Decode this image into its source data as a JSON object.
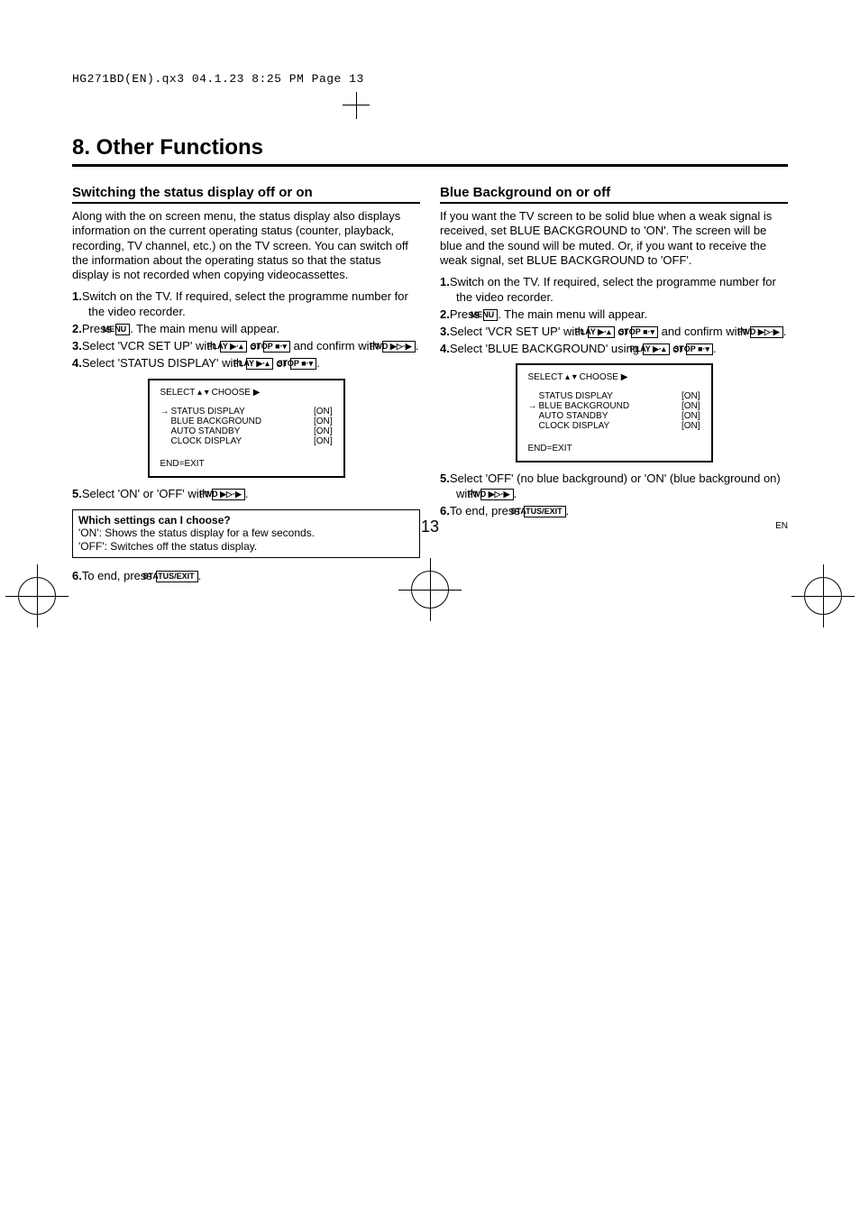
{
  "print_header": "HG271BD(EN).qx3  04.1.23  8:25 PM  Page 13",
  "chapter": "8. Other Functions",
  "left": {
    "title": "Switching the status display off or on",
    "intro": "Along with the on screen menu, the status display also displays information on the current operating status (counter, playback, recording, TV channel, etc.) on the TV screen. You can switch off the information about the operating status so that the status display is not recorded when copying videocassettes.",
    "steps_a": [
      {
        "n": "1.",
        "t": "Switch on the TV. If required, select the programme number for the video recorder."
      },
      {
        "n": "2.",
        "pre": "Press ",
        "btn": "MENU",
        "post": ". The main menu will appear."
      },
      {
        "n": "3.",
        "pre": "Select 'VCR SET UP' with ",
        "btn1": "PLAY ▶·▴",
        "mid": " or ",
        "btn2": "STOP ■·▾",
        "post2": " and confirm with ",
        "btn3": "FWD ▶▷·▶",
        "end": "."
      },
      {
        "n": "4.",
        "pre": "Select 'STATUS DISPLAY' with ",
        "btn1": "PLAY ▶·▴",
        "mid": " or ",
        "btn2": "STOP ■·▾",
        "end": "."
      }
    ],
    "osd": {
      "head": "SELECT ▴ ▾  CHOOSE ▶",
      "rows": [
        {
          "arrow": "→",
          "label": "STATUS DISPLAY",
          "val": "[ON]"
        },
        {
          "arrow": "",
          "label": "BLUE BACKGROUND",
          "val": "[ON]"
        },
        {
          "arrow": "",
          "label": "AUTO STANDBY",
          "val": "[ON]"
        },
        {
          "arrow": "",
          "label": "CLOCK DISPLAY",
          "val": "[ON]"
        }
      ],
      "foot": "END=EXIT"
    },
    "step5": {
      "n": "5.",
      "pre": "Select 'ON' or 'OFF' with ",
      "btn": "FWD ▶▷·▶",
      "end": "."
    },
    "info": {
      "title": "Which settings can I choose?",
      "on": "'ON': Shows the status display for a few seconds.",
      "off": "'OFF': Switches off the status display."
    },
    "step6": {
      "n": "6.",
      "pre": "To end, press ",
      "btn": "STATUS/EXIT",
      "end": "."
    }
  },
  "right": {
    "title": "Blue Background on or off",
    "intro": "If you want the TV screen to be solid blue when a weak signal is received, set BLUE BACKGROUND to 'ON'. The screen will be blue and the sound will be muted. Or, if you want to receive the weak signal, set BLUE BACKGROUND to 'OFF'.",
    "steps_a": [
      {
        "n": "1.",
        "t": "Switch on the TV. If required, select the programme number for the video recorder."
      },
      {
        "n": "2.",
        "pre": "Press ",
        "btn": "MENU",
        "post": ". The main menu will appear."
      },
      {
        "n": "3.",
        "pre": "Select 'VCR SET UP' with ",
        "btn1": "PLAY ▶·▴",
        "mid": " or ",
        "btn2": "STOP ■·▾",
        "post2": " and confirm with ",
        "btn3": "FWD ▶▷·▶",
        "end": "."
      },
      {
        "n": "4.",
        "pre": "Select 'BLUE BACKGROUND' using ",
        "btn1": "PLAY ▶·▴",
        "mid": " or ",
        "btn2": "STOP ■·▾",
        "end": "."
      }
    ],
    "osd": {
      "head": "SELECT ▴ ▾  CHOOSE ▶",
      "rows": [
        {
          "arrow": "",
          "label": "STATUS DISPLAY",
          "val": "[ON]"
        },
        {
          "arrow": "→",
          "label": "BLUE BACKGROUND",
          "val": "[ON]"
        },
        {
          "arrow": "",
          "label": "AUTO STANDBY",
          "val": "[ON]"
        },
        {
          "arrow": "",
          "label": "CLOCK DISPLAY",
          "val": "[ON]"
        }
      ],
      "foot": "END=EXIT"
    },
    "step5": {
      "n": "5.",
      "pre": "Select 'OFF' (no blue background) or 'ON' (blue background on) with ",
      "btn": "FWD ▶▷·▶",
      "end": "."
    },
    "step6": {
      "n": "6.",
      "pre": "To end, press ",
      "btn": "STATUS/EXIT",
      "end": "."
    }
  },
  "page_number": "13",
  "lang": "EN"
}
